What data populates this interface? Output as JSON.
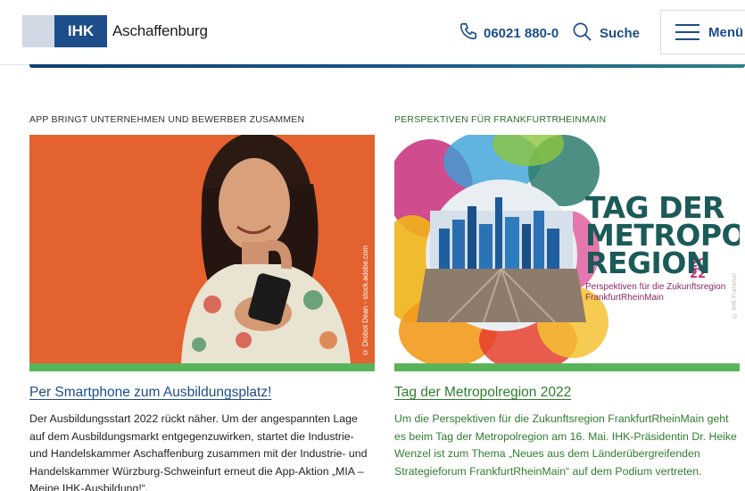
{
  "header": {
    "logo_mark": "IHK",
    "logo_name": "Aschaffenburg",
    "phone": "06021 880-0",
    "search_label": "Suche",
    "menu_label": "Menü"
  },
  "cards": [
    {
      "kicker": "APP BRINGT UNTERNEHMEN UND BEWERBER ZUSAMMEN",
      "image_credit": "© Drobot Dean - stock.adobe.com",
      "title": "Per Smartphone zum Ausbildungsplatz!",
      "text": "Der Ausbildungsstart 2022 rückt näher. Um der angespannten Lage auf dem Ausbildungsmarkt entgegenzuwirken, startet die Industrie- und Handelskammer Aschaffenburg zusammen mit der Industrie- und Handelskammer Würzburg-Schweinfurt erneut die App-Aktion „MIA – Meine IHK-Ausbildung!“."
    },
    {
      "kicker": "PERSPEKTIVEN FÜR FRANKFURTRHEINMAIN",
      "image_title_lines": [
        "TAG DER",
        "METROPOL",
        "REGION"
      ],
      "image_year": "2022",
      "image_subtitle_lines": [
        "Perspektiven für die Zukunftsregion",
        "FrankfurtRheinMain"
      ],
      "image_credit": "© IHK Frankfurt",
      "title": "Tag der Metropolregion 2022",
      "text": "Um die Perspektiven für die Zukunftsregion FrankfurtRheinMain geht es beim Tag der Metropolregion am 16. Mai. IHK-Präsidentin Dr. Heike Wenzel ist zum Thema „Neues aus dem Länderübergreifenden Strategieforum FrankfurtRheinMain“ auf dem Podium vertreten."
    }
  ],
  "colors": {
    "brand_blue": "#1d4e89",
    "accent_green": "#59b35a",
    "link_green": "#2f7d2e"
  }
}
